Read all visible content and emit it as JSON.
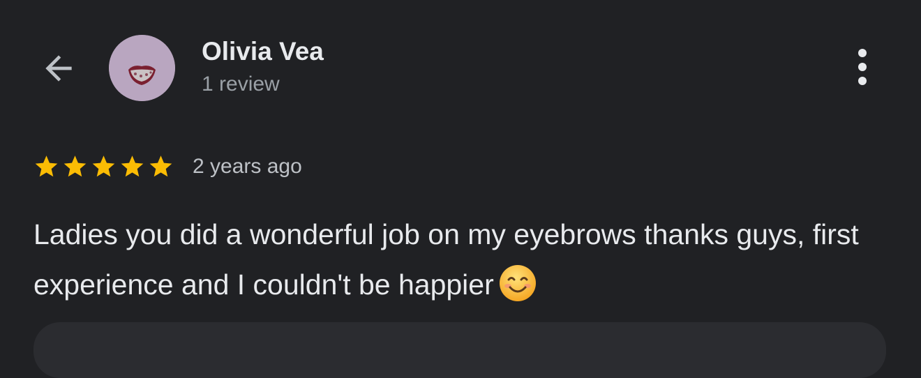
{
  "header": {
    "back_icon": "arrow-left-icon",
    "more_icon": "more-vertical-icon"
  },
  "reviewer": {
    "name": "Olivia Vea",
    "review_count": "1 review",
    "avatar_icon": "lips-avatar"
  },
  "review": {
    "rating": 5,
    "max_rating": 5,
    "star_color": "#fbbc04",
    "time_ago": "2 years ago",
    "text": "Ladies you did a wonderful job on my eyebrows thanks guys, first experience and I couldn't be happier",
    "emoji": "smiling-face-emoji"
  },
  "colors": {
    "background": "#202124",
    "primary_text": "#e8eaed",
    "secondary_text": "#9aa0a6"
  }
}
